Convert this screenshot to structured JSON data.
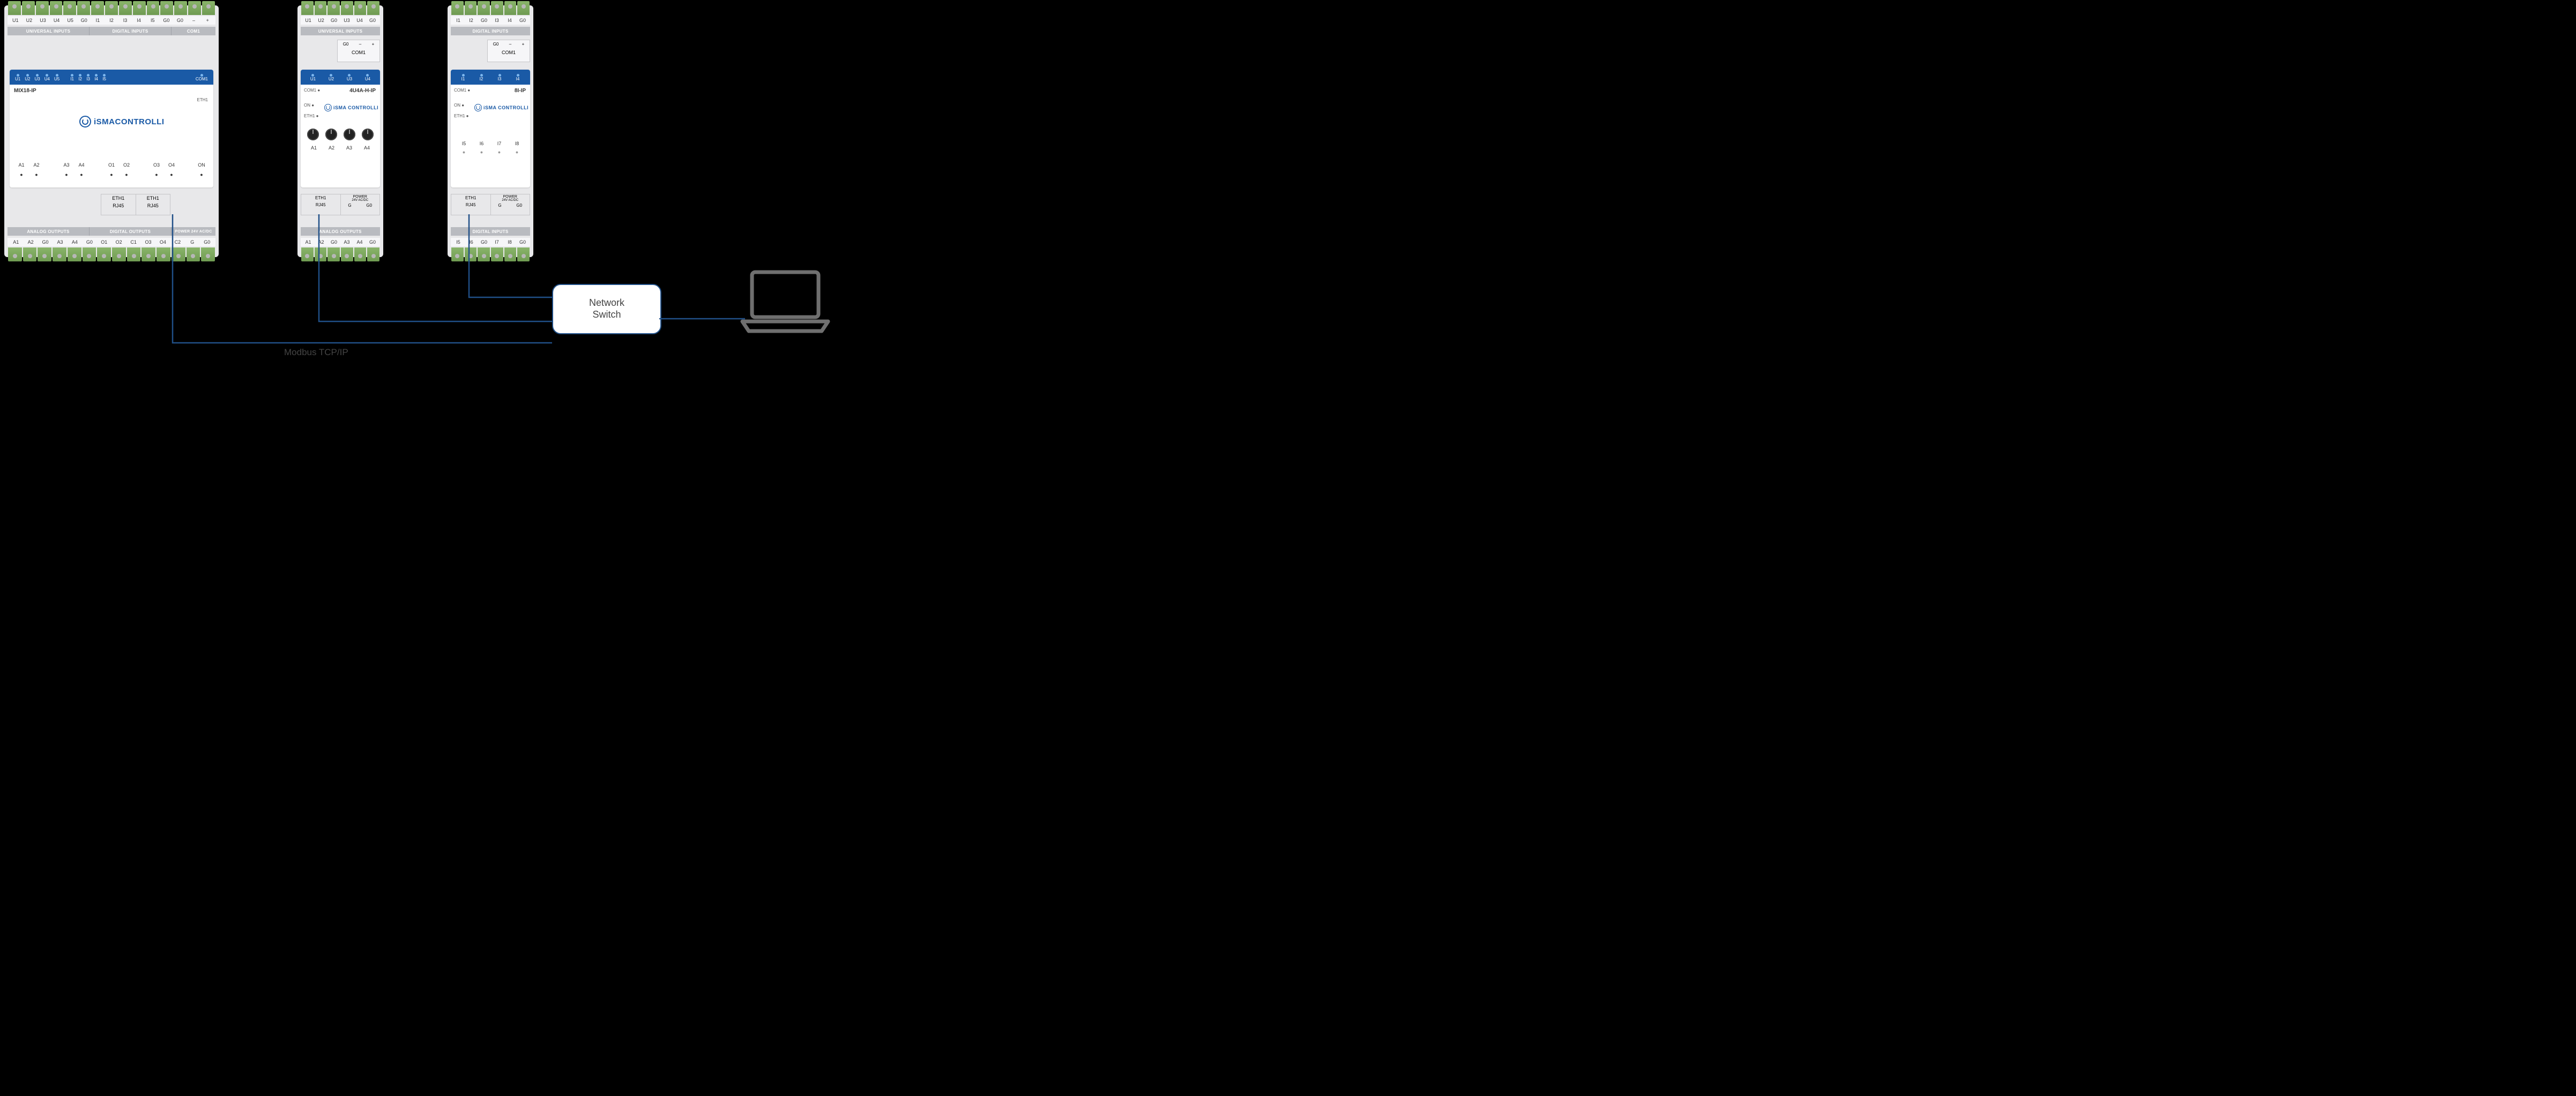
{
  "protocol_label": "Modbus TCP/IP",
  "switch_label": "Network\nSwitch",
  "module1": {
    "top_terminals": [
      "U1",
      "U2",
      "U3",
      "U4",
      "U5",
      "G0",
      "I1",
      "I2",
      "I3",
      "I4",
      "I5",
      "G0",
      "G0",
      "–",
      "+"
    ],
    "top_section_left": "UNIVERSAL INPUTS",
    "top_section_mid": "DIGITAL INPUTS",
    "top_section_right": "COM1",
    "led_row1": [
      "U1",
      "U2",
      "U3",
      "U4",
      "U5"
    ],
    "led_row2": [
      "I1",
      "I2",
      "I3",
      "I4",
      "I5"
    ],
    "led_com": "COM1",
    "model": "MIX18-IP",
    "eth_label": "ETH1",
    "brand": "iSMACONTROLLI",
    "mid_left": [
      "A1",
      "A2",
      "",
      "A3",
      "A4"
    ],
    "mid_right": [
      "O1",
      "O2",
      "",
      "O3",
      "O4",
      "",
      "ON"
    ],
    "port_labels_left": "ETH1",
    "port_labels_right": "ETH1",
    "port_sub_left": "RJ45",
    "port_sub_right": "RJ45",
    "bot_section1": "ANALOG OUTPUTS",
    "bot_section2": "DIGITAL OUTPUTS",
    "bot_section3": "POWER 24V AC/DC",
    "bot_terminals": [
      "A1",
      "A2",
      "G0",
      "A3",
      "A4",
      "G0",
      "O1",
      "O2",
      "C1",
      "O3",
      "O4",
      "C2",
      "G",
      "G0"
    ]
  },
  "module2": {
    "top_terminals": [
      "U1",
      "U2",
      "G0",
      "U3",
      "U4",
      "G0"
    ],
    "top_section": "UNIVERSAL INPUTS",
    "com_row": [
      "G0",
      "–",
      "+"
    ],
    "com_label": "COM1",
    "leds": [
      "U1",
      "U2",
      "U3",
      "U4"
    ],
    "model": "4U4A-H-IP",
    "side_com1": "COM1",
    "side_on": "ON",
    "side_eth1": "ETH1",
    "brand": "iSMA CONTROLLI",
    "knob_labels": [
      "A1",
      "A2",
      "A3",
      "A4"
    ],
    "port_label": "ETH1",
    "port_sub": "RJ45",
    "power_label": "POWER",
    "power_sub": "24V AC/DC",
    "power_pins": [
      "G",
      "G0"
    ],
    "bot_section": "ANALOG OUTPUTS",
    "bot_terminals": [
      "A1",
      "A2",
      "G0",
      "A3",
      "A4",
      "G0"
    ]
  },
  "module3": {
    "top_terminals": [
      "I1",
      "I2",
      "G0",
      "I3",
      "I4",
      "G0"
    ],
    "top_section": "DIGITAL INPUTS",
    "com_row": [
      "G0",
      "–",
      "+"
    ],
    "com_label": "COM1",
    "leds": [
      "I1",
      "I2",
      "I3",
      "I4"
    ],
    "model": "8I-IP",
    "side_com1": "COM1",
    "side_on": "ON",
    "side_eth1": "ETH1",
    "brand": "iSMA CONTROLLI",
    "lower_leds": [
      "I5",
      "I6",
      "I7",
      "I8"
    ],
    "port_label": "ETH1",
    "port_sub": "RJ45",
    "power_label": "POWER",
    "power_sub": "24V AC/DC",
    "power_pins": [
      "G",
      "G0"
    ],
    "bot_section": "DIGITAL INPUTS",
    "bot_terminals": [
      "I5",
      "I6",
      "G0",
      "I7",
      "I8",
      "G0"
    ]
  }
}
